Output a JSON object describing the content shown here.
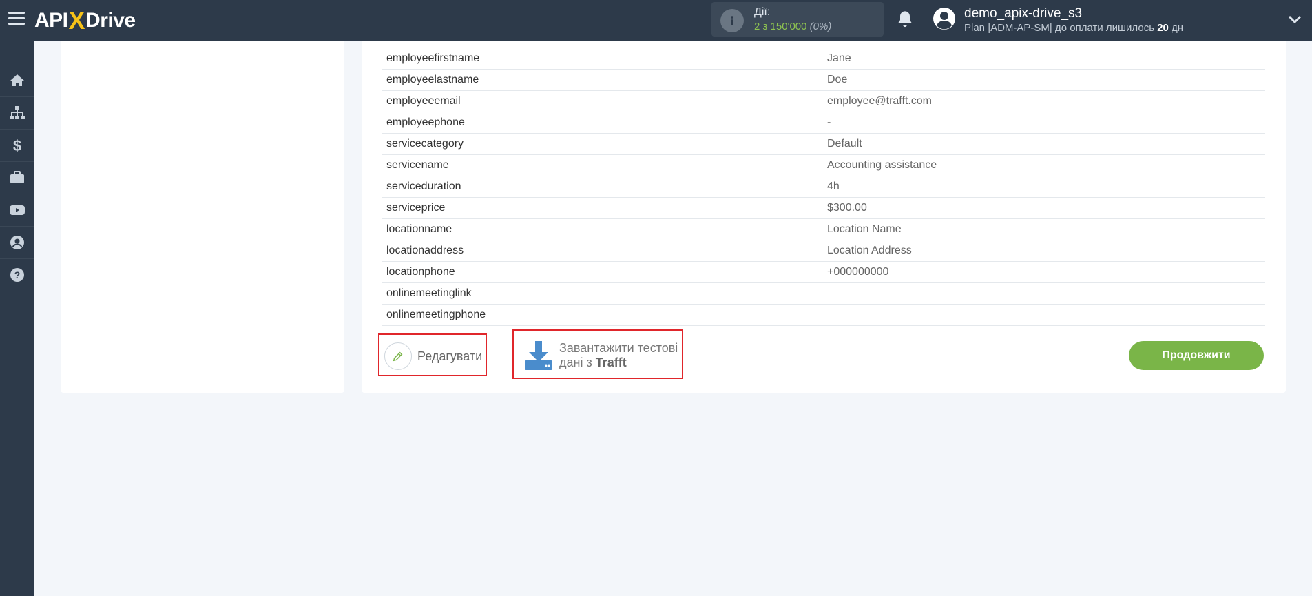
{
  "header": {
    "logo_left": "API",
    "logo_x": "X",
    "logo_right": "Drive",
    "actions_label": "Дії:",
    "actions_count": "2 з 150'000",
    "actions_pct": "(0%)",
    "user_name": "demo_apix-drive_s3",
    "plan_prefix": "Plan |ADM-AP-SM| до оплати лишилось ",
    "plan_days": "20",
    "plan_suffix": " дн"
  },
  "table": {
    "rows": [
      {
        "key": "employeefirstname",
        "value": "Jane"
      },
      {
        "key": "employeelastname",
        "value": "Doe"
      },
      {
        "key": "employeeemail",
        "value": "employee@trafft.com"
      },
      {
        "key": "employeephone",
        "value": "-"
      },
      {
        "key": "servicecategory",
        "value": "Default"
      },
      {
        "key": "servicename",
        "value": "Accounting assistance"
      },
      {
        "key": "serviceduration",
        "value": "4h"
      },
      {
        "key": "serviceprice",
        "value": "$300.00"
      },
      {
        "key": "locationname",
        "value": "Location Name"
      },
      {
        "key": "locationaddress",
        "value": "Location Address"
      },
      {
        "key": "locationphone",
        "value": "+000000000"
      },
      {
        "key": "onlinemeetinglink",
        "value": ""
      },
      {
        "key": "onlinemeetingphone",
        "value": ""
      }
    ]
  },
  "buttons": {
    "edit_label": "Редагувати",
    "load_line1": "Завантажити тестові",
    "load_line2_prefix": "дані з ",
    "load_source": "Trafft",
    "continue_label": "Продовжити"
  },
  "colors": {
    "topbar": "#2d3a4a",
    "accent_green": "#7ab548",
    "highlight_red": "#e0262b",
    "logo_x": "#f7c318"
  },
  "icons": [
    "menu-icon",
    "info-icon",
    "bell-icon",
    "avatar-icon",
    "chevron-down-icon",
    "home-icon",
    "sitemap-icon",
    "dollar-icon",
    "briefcase-icon",
    "youtube-icon",
    "user-icon",
    "help-icon",
    "pencil-icon",
    "download-icon"
  ]
}
